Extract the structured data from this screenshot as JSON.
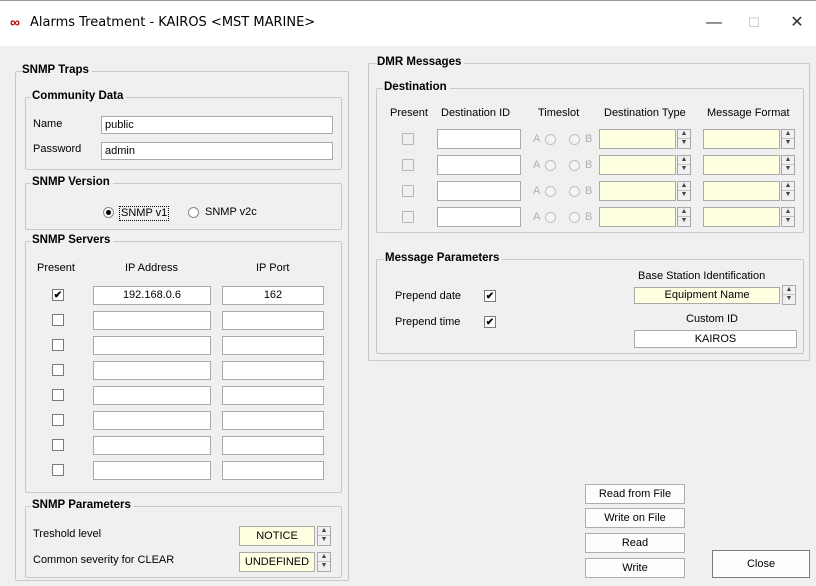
{
  "window": {
    "title": "Alarms Treatment - KAIROS <MST MARINE>",
    "app_icon": "infinity-icon",
    "minimize": "—",
    "maximize": "☐",
    "close": "✕"
  },
  "snmp_traps": {
    "legend": "SNMP Traps",
    "community": {
      "legend": "Community Data",
      "name_label": "Name",
      "name_value": "public",
      "password_label": "Password",
      "password_value": "admin"
    },
    "version": {
      "legend": "SNMP Version",
      "v1_label": "SNMP v1",
      "v2c_label": "SNMP v2c",
      "selected": "SNMP v1"
    },
    "servers": {
      "legend": "SNMP Servers",
      "col_present": "Present",
      "col_ip": "IP Address",
      "col_port": "IP Port",
      "rows": [
        {
          "present": true,
          "ip": "192.168.0.6",
          "port": "162"
        },
        {
          "present": false,
          "ip": "",
          "port": ""
        },
        {
          "present": false,
          "ip": "",
          "port": ""
        },
        {
          "present": false,
          "ip": "",
          "port": ""
        },
        {
          "present": false,
          "ip": "",
          "port": ""
        },
        {
          "present": false,
          "ip": "",
          "port": ""
        },
        {
          "present": false,
          "ip": "",
          "port": ""
        },
        {
          "present": false,
          "ip": "",
          "port": ""
        }
      ]
    },
    "parameters": {
      "legend": "SNMP Parameters",
      "threshold_label": "Treshold level",
      "threshold_value": "NOTICE",
      "clear_label": "Common severity for CLEAR",
      "clear_value": "UNDEFINED"
    }
  },
  "dmr": {
    "legend": "DMR Messages",
    "destination": {
      "legend": "Destination",
      "col_present": "Present",
      "col_dest_id": "Destination ID",
      "col_timeslot": "Timeslot",
      "col_dest_type": "Destination Type",
      "col_msg_format": "Message Format",
      "slot_a": "A",
      "slot_b": "B"
    },
    "message_params": {
      "legend": "Message Parameters",
      "prepend_date_label": "Prepend date",
      "prepend_date": true,
      "prepend_time_label": "Prepend time",
      "prepend_time": true,
      "base_station_label": "Base Station Identification",
      "base_station_value": "Equipment Name",
      "custom_id_label": "Custom ID",
      "custom_id_value": "KAIROS"
    }
  },
  "buttons": {
    "read_from_file": "Read from File",
    "write_on_file": "Write on File",
    "read": "Read",
    "write": "Write",
    "close": "Close"
  }
}
